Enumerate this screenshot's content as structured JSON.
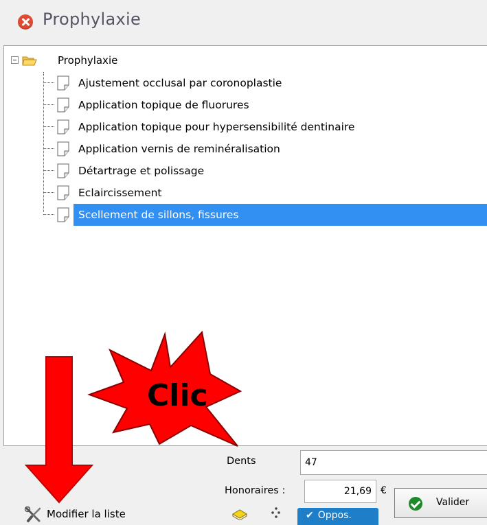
{
  "window": {
    "title": "Prophylaxie"
  },
  "tree": {
    "root_label": "Prophylaxie",
    "items": [
      {
        "label": "Ajustement occlusal par coronoplastie"
      },
      {
        "label": "Application topique de fluorures"
      },
      {
        "label": "Application topique pour hypersensibilité dentinaire"
      },
      {
        "label": "Application vernis de reminéralisation"
      },
      {
        "label": "Détartrage et polissage"
      },
      {
        "label": "Eclaircissement"
      },
      {
        "label": "Scellement de sillons, fissures"
      }
    ],
    "selected_index": 6
  },
  "form": {
    "dents_label": "Dents",
    "dents_value": "47",
    "honoraires_label": "Honoraires :",
    "honoraires_value": "21,69",
    "currency": "€"
  },
  "buttons": {
    "valider_label": "Valider",
    "modifier_label": "Modifier la liste",
    "oppos_label": "Oppos."
  },
  "annotation": {
    "text": "Clic",
    "arrow_color": "#ff0000",
    "star_color": "#ff0000"
  },
  "colors": {
    "selection": "#3390f3",
    "close": "#e04a33",
    "oppos": "#1e7fc8",
    "check": "#1f8a2a"
  }
}
